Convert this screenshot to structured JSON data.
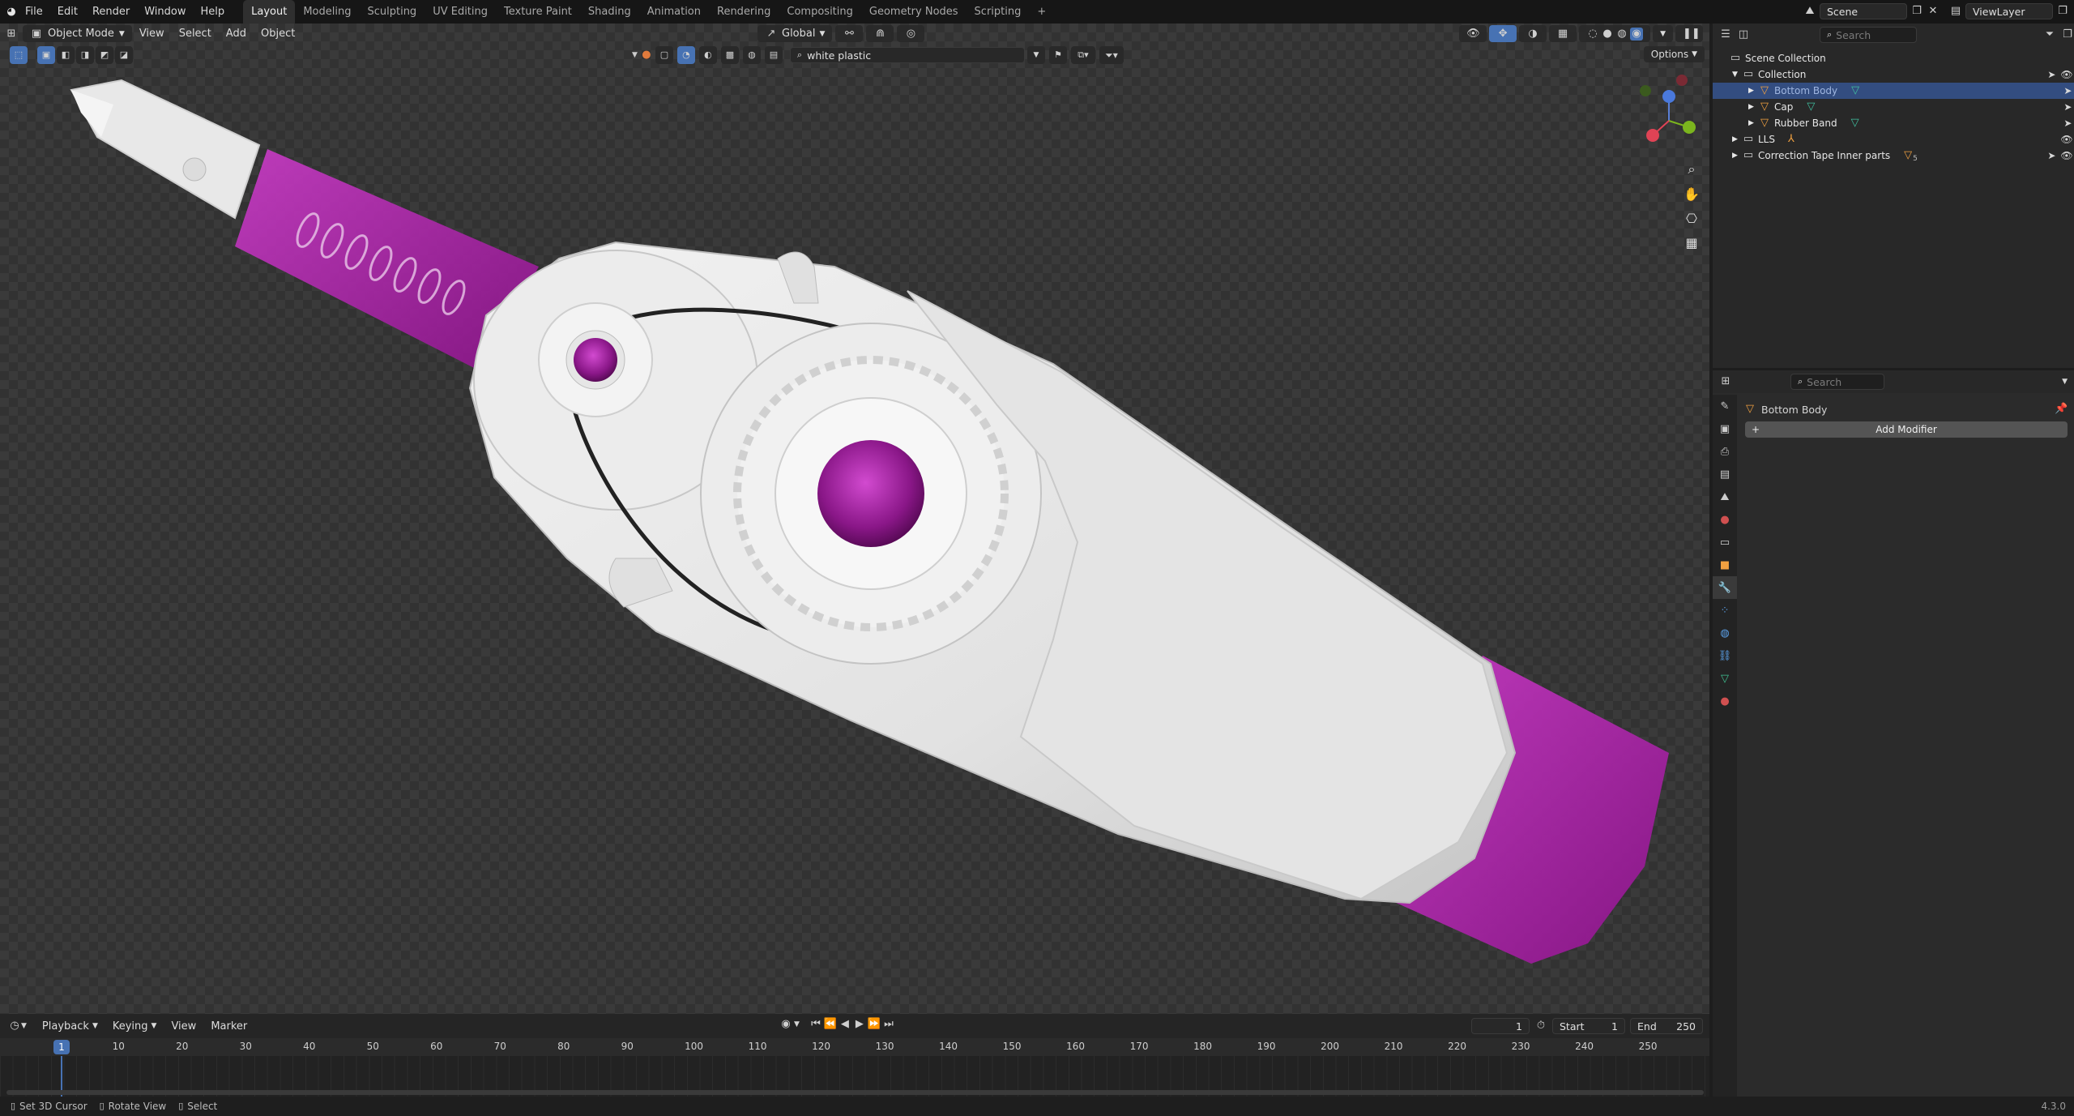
{
  "menu": [
    "File",
    "Edit",
    "Render",
    "Window",
    "Help"
  ],
  "workspaces": [
    "Layout",
    "Modeling",
    "Sculpting",
    "UV Editing",
    "Texture Paint",
    "Shading",
    "Animation",
    "Rendering",
    "Compositing",
    "Geometry Nodes",
    "Scripting"
  ],
  "workspace_add": "+",
  "scene": "Scene",
  "view_layer": "ViewLayer",
  "viewport": {
    "mode": "Object Mode",
    "menus": [
      "View",
      "Select",
      "Add",
      "Object"
    ],
    "transform_orientation": "Global",
    "material_search": "white plastic",
    "options_label": "Options"
  },
  "outliner": {
    "search_placeholder": "Search",
    "items": [
      {
        "label": "Scene Collection"
      },
      {
        "label": "Collection"
      },
      {
        "label": "Bottom Body"
      },
      {
        "label": "Cap"
      },
      {
        "label": "Rubber Band"
      },
      {
        "label": "LLS"
      },
      {
        "label": "Correction Tape Inner parts",
        "badge": "5"
      }
    ]
  },
  "properties": {
    "search_placeholder": "Search",
    "object_name": "Bottom Body",
    "add_modifier": "Add Modifier"
  },
  "timeline": {
    "menus": [
      "Playback",
      "Keying",
      "View",
      "Marker"
    ],
    "current_frame": "1",
    "start_label": "Start",
    "start": "1",
    "end_label": "End",
    "end": "250",
    "ticks": [
      "10",
      "20",
      "30",
      "40",
      "50",
      "60",
      "70",
      "80",
      "90",
      "100",
      "110",
      "120",
      "130",
      "140",
      "150",
      "160",
      "170",
      "180",
      "190",
      "200",
      "210",
      "220",
      "230",
      "240",
      "250"
    ],
    "playhead": "1"
  },
  "status": {
    "items": [
      "Set 3D Cursor",
      "Rotate View",
      "Select"
    ],
    "version": "4.3.0"
  },
  "colors": {
    "accent": "#4772b3",
    "selection": "#334d80",
    "magenta": "#b01cad",
    "plastic": "#e6e6e6"
  }
}
